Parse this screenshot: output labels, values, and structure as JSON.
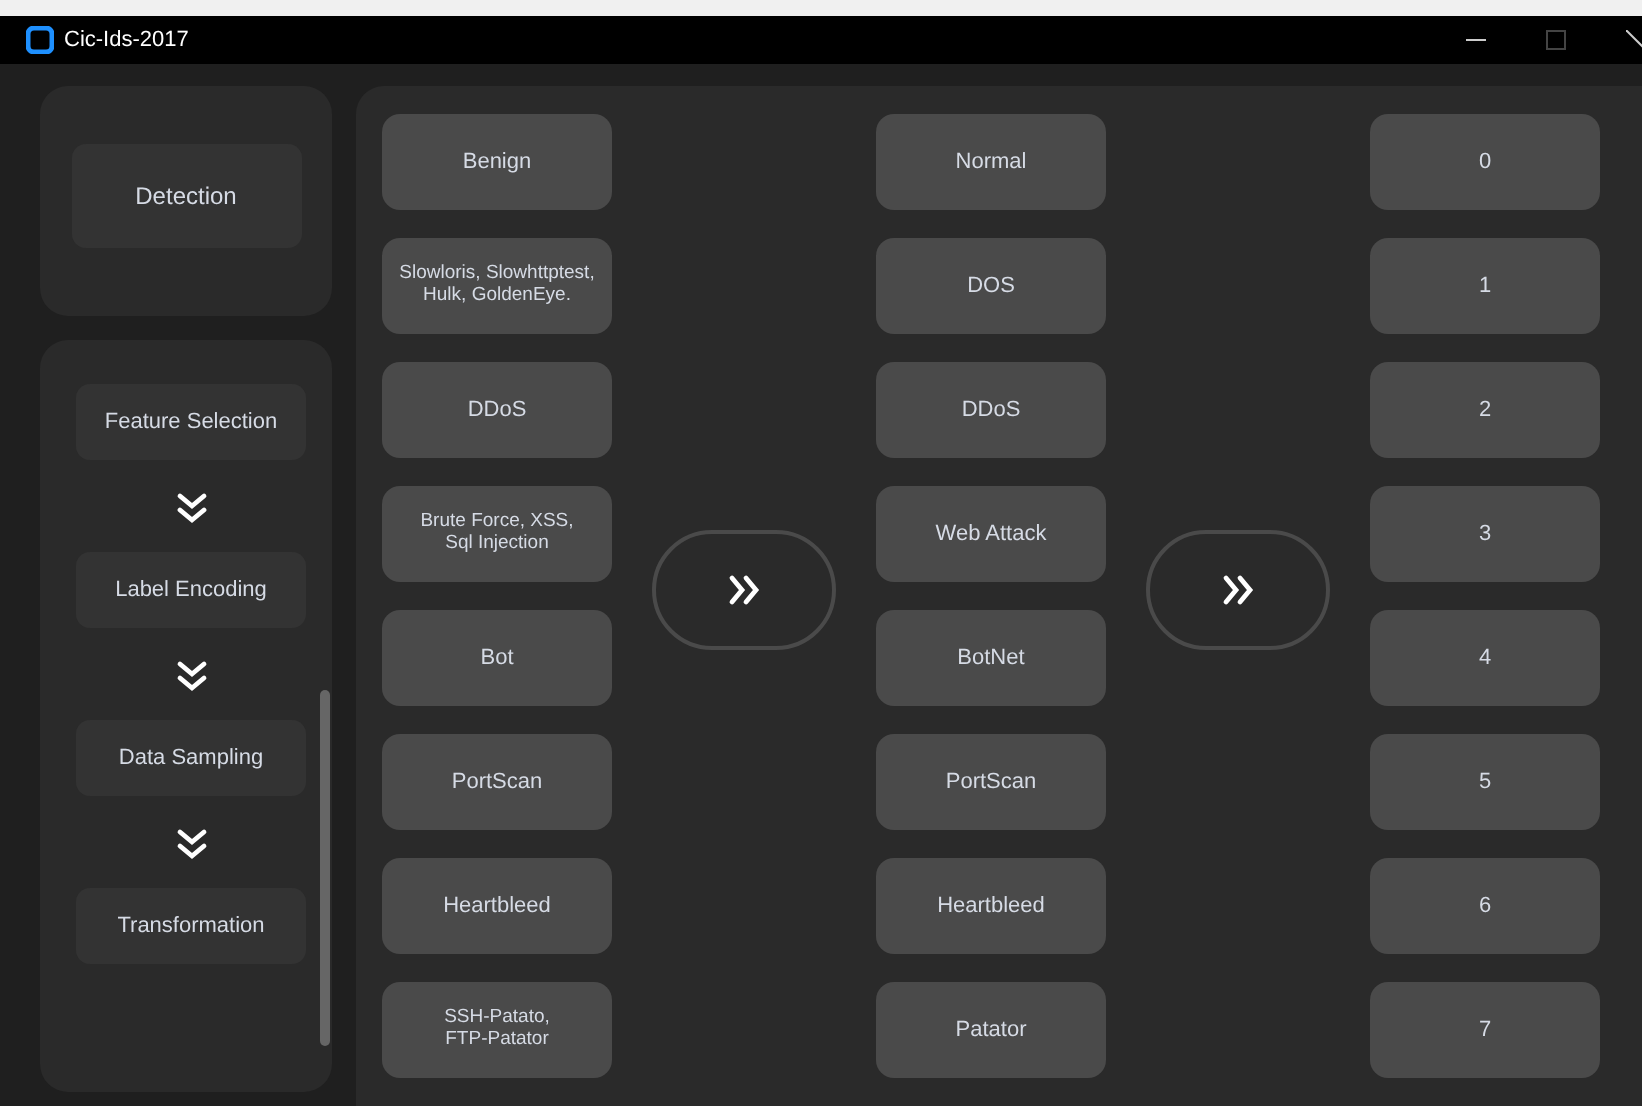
{
  "window": {
    "title": "Cic-Ids-2017"
  },
  "detection": {
    "label": "Detection"
  },
  "pipeline": [
    "Feature Selection",
    "Label Encoding",
    "Data Sampling",
    "Transformation"
  ],
  "attacks": [
    "Benign",
    "Slowloris, Slowhttptest,\nHulk, GoldenEye.",
    "DDoS",
    "Brute Force, XSS,\nSql Injection",
    "Bot",
    "PortScan",
    "Heartbleed",
    "SSH-Patato,\nFTP-Patator"
  ],
  "categories": [
    "Normal",
    "DOS",
    "DDoS",
    "Web Attack",
    "BotNet",
    "PortScan",
    "Heartbleed",
    "Patator"
  ],
  "codes": [
    "0",
    "1",
    "2",
    "3",
    "4",
    "5",
    "6",
    "7"
  ]
}
